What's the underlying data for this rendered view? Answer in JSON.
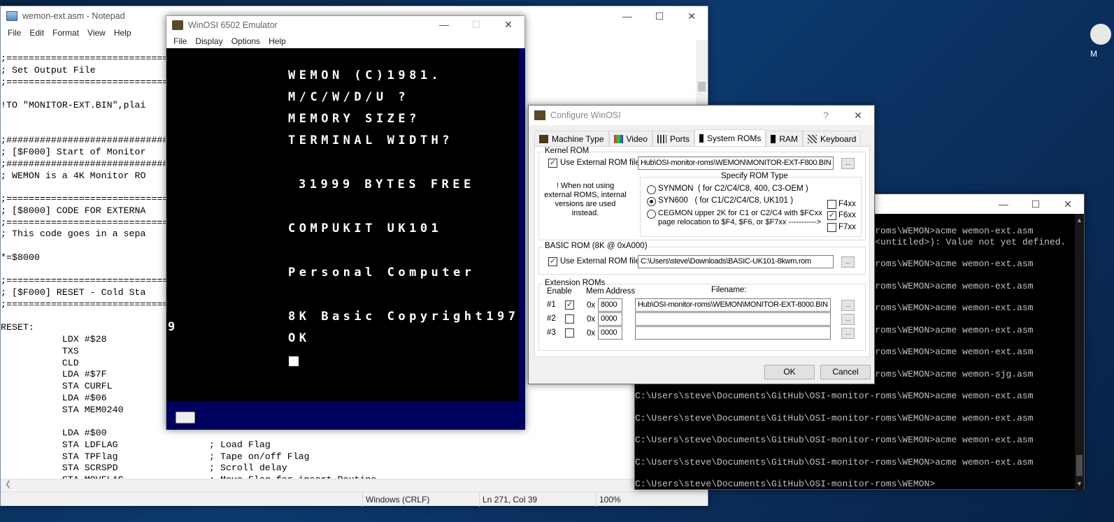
{
  "desktop": {
    "icon_label": "M"
  },
  "notepad": {
    "title": "wemon-ext.asm - Notepad",
    "menu": [
      "File",
      "Edit",
      "Format",
      "View",
      "Help"
    ],
    "lines": [
      {
        "t": ";======================================================"
      },
      {
        "t": "; Set Output File"
      },
      {
        "t": ";======================================================"
      },
      {
        "t": ""
      },
      {
        "t": "!TO \"MONITOR-EXT.BIN\",plai"
      },
      {
        "t": ""
      },
      {
        "t": ""
      },
      {
        "t": ";######################################################"
      },
      {
        "t": "; [$F000] Start of Monitor"
      },
      {
        "t": ";######################################################"
      },
      {
        "t": "; WEMON is a 4K Monitor RO"
      },
      {
        "t": ""
      },
      {
        "t": ";======================================================"
      },
      {
        "t": "; [$8000] CODE FOR EXTERNA"
      },
      {
        "t": ";======================================================"
      },
      {
        "t": "; This code goes in a sepa"
      },
      {
        "t": ""
      },
      {
        "t": "*=$8000"
      },
      {
        "t": ""
      },
      {
        "t": ";======================================================"
      },
      {
        "t": "; [$F000] RESET - Cold Sta"
      },
      {
        "t": ";======================================================"
      },
      {
        "t": ""
      },
      {
        "t": "RESET:"
      },
      {
        "t": "           LDX #$28"
      },
      {
        "t": "           TXS"
      },
      {
        "t": "           CLD"
      },
      {
        "t": "           LDA #$7F"
      },
      {
        "t": "           STA CURFL"
      },
      {
        "t": "           LDA #$06"
      },
      {
        "t": "           STA MEM0240"
      },
      {
        "t": ""
      },
      {
        "t": "           LDA #$00"
      },
      {
        "t": "           STA LDFLAG",
        "c": "; Load Flag"
      },
      {
        "t": "           STA TPFlag",
        "c": "; Tape on/off Flag"
      },
      {
        "t": "           STA SCRSPD",
        "c": "; Scroll delay"
      },
      {
        "t": "           STA MOVFLAG",
        "c": "; Move Flag for insert Routine"
      }
    ],
    "status": {
      "line_ending": "Windows (CRLF)",
      "position": "Ln 271, Col 39",
      "zoom": "100%"
    }
  },
  "emulator": {
    "title": "WinOSI 6502 Emulator",
    "menu": [
      "File",
      "Display",
      "Options",
      "Help"
    ],
    "screen": [
      "WEMON (C)1981.",
      "M/C/W/D/U ?",
      "MEMORY SIZE?",
      "TERMINAL WIDTH?",
      "",
      "31999 BYTES FREE",
      "",
      "COMPUKIT UK101",
      "",
      "Personal Computer",
      "",
      "8K Basic Copyright197",
      "OK"
    ],
    "wrap_char": "9"
  },
  "config": {
    "title": "Configure WinOSI",
    "help": "?",
    "tabs": [
      "Machine Type",
      "Video",
      "Ports",
      "System ROMs",
      "RAM",
      "Keyboard"
    ],
    "active_tab": "System ROMs",
    "kernel": {
      "group": "Kernel ROM",
      "use_external_label": "Use External ROM file:",
      "use_external": true,
      "file": "Hub\\OSI-monitor-roms\\WEMON\\MONITOR-EXT-F800.BIN",
      "note": "! When not using external ROMS, internal versions are used instead.",
      "rom_type_group": "Specify ROM Type",
      "options": [
        {
          "name": "SYNMON",
          "desc": "( for C2/C4/C8, 400, C3-OEM )",
          "selected": false
        },
        {
          "name": "SYN600",
          "desc": "( for C1/C2/C4/C8, UK101 )",
          "selected": true
        },
        {
          "name": "CEGMON upper 2K for C1 or C2/C4 with $FCxx",
          "desc": "page relocation to $F4, $F6, or $F7xx ----------->",
          "selected": false
        }
      ],
      "pages": [
        {
          "label": "F4xx",
          "checked": false
        },
        {
          "label": "F6xx",
          "checked": true
        },
        {
          "label": "F7xx",
          "checked": false
        }
      ]
    },
    "basic": {
      "group": "BASIC ROM (8K @ 0xA000)",
      "use_external_label": "Use External ROM file:",
      "use_external": true,
      "file": "C:\\Users\\steve\\Downloads\\BASIC-UK101-8kwm.rom"
    },
    "ext": {
      "group": "Extension ROMs",
      "h_enable": "Enable",
      "h_addr": "Mem Address",
      "h_file": "Filename:",
      "prefix": "0x",
      "rows": [
        {
          "num": "#1",
          "enabled": true,
          "addr": "8000",
          "file": "Hub\\OSI-monitor-roms\\WEMON\\MONITOR-EXT-8000.BIN"
        },
        {
          "num": "#2",
          "enabled": false,
          "addr": "0000",
          "file": ""
        },
        {
          "num": "#3",
          "enabled": false,
          "addr": "0000",
          "file": ""
        }
      ]
    },
    "browse": "...",
    "ok": "OK",
    "cancel": "Cancel"
  },
  "console": {
    "lines": [
      "C:\\Users\\steve\\Documents\\GitHub\\OSI-monitor-roms\\WEMON>acme wemon-ext.asm",
      "                                            <untitled>): Value not yet defined.",
      "",
      "C:\\Users\\steve\\Documents\\GitHub\\OSI-monitor-roms\\WEMON>acme wemon-ext.asm",
      "",
      "C:\\Users\\steve\\Documents\\GitHub\\OSI-monitor-roms\\WEMON>acme wemon-ext.asm",
      "",
      "C:\\Users\\steve\\Documents\\GitHub\\OSI-monitor-roms\\WEMON>acme wemon-ext.asm",
      "",
      "C:\\Users\\steve\\Documents\\GitHub\\OSI-monitor-roms\\WEMON>acme wemon-ext.asm",
      "",
      "C:\\Users\\steve\\Documents\\GitHub\\OSI-monitor-roms\\WEMON>acme wemon-ext.asm",
      "",
      "C:\\Users\\steve\\Documents\\GitHub\\OSI-monitor-roms\\WEMON>acme wemon-sjg.asm",
      "",
      "C:\\Users\\steve\\Documents\\GitHub\\OSI-monitor-roms\\WEMON>acme wemon-ext.asm",
      "",
      "C:\\Users\\steve\\Documents\\GitHub\\OSI-monitor-roms\\WEMON>acme wemon-ext.asm",
      "",
      "C:\\Users\\steve\\Documents\\GitHub\\OSI-monitor-roms\\WEMON>acme wemon-ext.asm",
      "",
      "C:\\Users\\steve\\Documents\\GitHub\\OSI-monitor-roms\\WEMON>acme wemon-ext.asm",
      "",
      "C:\\Users\\steve\\Documents\\GitHub\\OSI-monitor-roms\\WEMON>"
    ]
  }
}
